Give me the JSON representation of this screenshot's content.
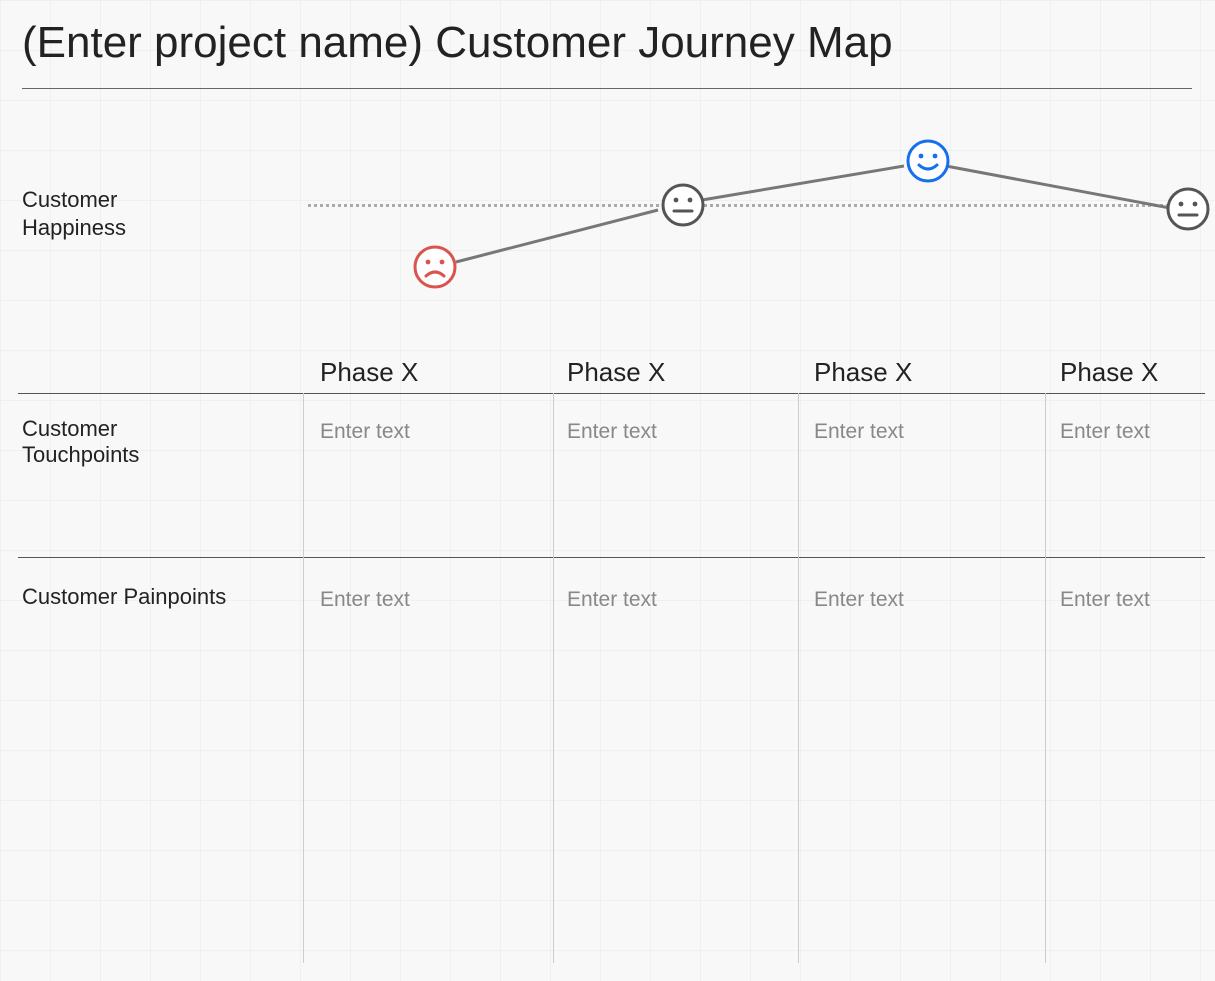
{
  "title": "(Enter project name) Customer Journey Map",
  "happiness_label": "Customer\nHappiness",
  "phases": [
    "Phase X",
    "Phase X",
    "Phase X",
    "Phase X"
  ],
  "rows": {
    "touchpoints": {
      "label": "Customer\nTouchpoints",
      "cells": [
        "Enter text",
        "Enter text",
        "Enter text",
        "Enter text"
      ]
    },
    "painpoints": {
      "label": "Customer Painpoints",
      "cells": [
        "Enter text",
        "Enter text",
        "Enter text",
        "Enter text"
      ]
    }
  },
  "chart_data": {
    "type": "line",
    "title": "Customer Happiness",
    "ylabel": "Happiness",
    "xlabel": "Phase",
    "categories": [
      "Phase X",
      "Phase X",
      "Phase X",
      "Phase X"
    ],
    "series": [
      {
        "name": "Customer Happiness",
        "values": [
          "sad",
          "neutral",
          "happy",
          "neutral"
        ]
      }
    ],
    "baseline": "neutral",
    "colors": {
      "sad": "#d9534f",
      "neutral": "#555",
      "happy": "#1570ef"
    }
  }
}
